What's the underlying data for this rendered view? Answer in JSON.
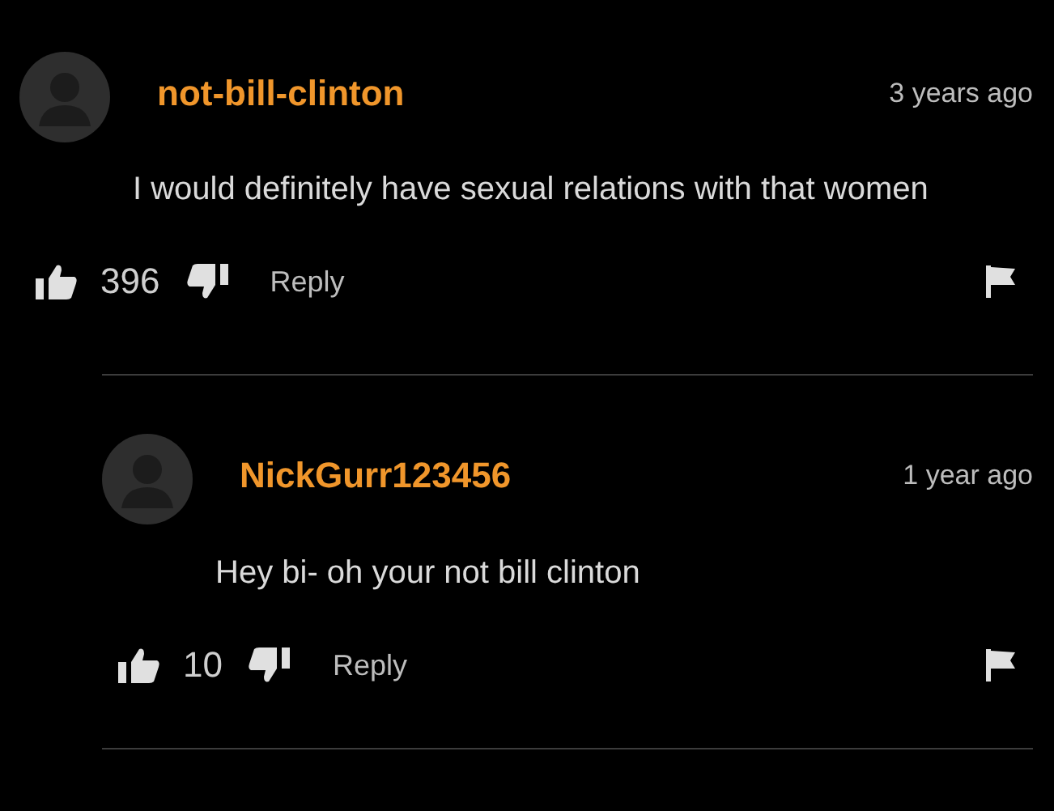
{
  "comments": [
    {
      "username": "not-bill-clinton",
      "time": "3 years ago",
      "text": "I would definitely have sexual relations with that women",
      "likes": "396",
      "reply": "Reply",
      "children": [
        {
          "username": "NickGurr123456",
          "time": "1 year ago",
          "text": "Hey bi- oh your not bill clinton",
          "likes": "10",
          "reply": "Reply"
        }
      ]
    }
  ]
}
